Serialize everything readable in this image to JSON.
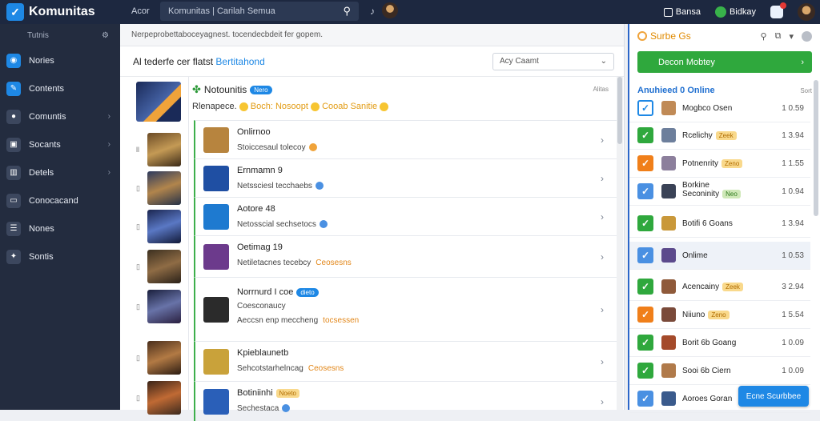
{
  "brand": {
    "name": "Komunitas"
  },
  "topbar": {
    "nav_label": "Acor",
    "search_text": "Komunitas | Carilah Semua",
    "pills": [
      {
        "label": "Bansa"
      },
      {
        "label": "Bidkay"
      }
    ]
  },
  "sidebar": {
    "header": "Tutnis",
    "items": [
      {
        "label": "Nories",
        "icon": "chat-icon",
        "color": "#1e88e5"
      },
      {
        "label": "Contents",
        "icon": "pencil-icon",
        "color": "#1e88e5"
      },
      {
        "label": "Comuntis",
        "icon": "bubble-icon",
        "color": "#3c475e"
      },
      {
        "label": "Socants",
        "icon": "box-icon",
        "color": "#3c475e"
      },
      {
        "label": "Detels",
        "icon": "chart-icon",
        "color": "#3c475e"
      },
      {
        "label": "Conocacand",
        "icon": "monitor-icon",
        "color": "#3c475e"
      },
      {
        "label": "Nones",
        "icon": "list-icon",
        "color": "#3c475e"
      },
      {
        "label": "Sontis",
        "icon": "pin-icon",
        "color": "#3c475e"
      }
    ]
  },
  "main": {
    "notice": "Nerpeprobettaboceyagnest. tocendecbdeit fer gopem.",
    "filter_title": "Al tederfe cer flatst",
    "filter_link": "Bertitahond",
    "select_value": "Acy Caamt",
    "feature": {
      "title": "Notounitis",
      "pill": "Nero",
      "subtitle_start": "Rlenapece.",
      "subtitle_mid": "Boch: Nosoopt",
      "subtitle_end": "Cooab Sanitie",
      "tag": "Alitas"
    },
    "rows": [
      {
        "title": "Onlirnoo",
        "sub": "Stoiccesaul tolecoy",
        "chip": "",
        "sub_chip": ""
      },
      {
        "title": "Ernmamn 9",
        "sub": "Netssciesl tecchaebs",
        "chip": "",
        "sub_chip": ""
      },
      {
        "title": "Aotore 48",
        "sub": "Netosscial sechsetocs",
        "chip": "",
        "sub_chip": ""
      },
      {
        "title": "Oetimag 19",
        "sub": "Netiletacnes tecebcy",
        "chip": "",
        "sub_chip": "Ceosesns"
      },
      {
        "title": "Norrnurd I coe",
        "sub2": "Coesconaucy",
        "sub": "Aeccsn enp meccheng",
        "chip": "dieto",
        "sub_chip": "tocsessen"
      },
      {
        "title": "Kpieblaunetb",
        "sub": "Sehcotstarhelncag",
        "chip": "",
        "sub_chip": "Ceosesns"
      },
      {
        "title": "Botiniinhi",
        "sub": "Sechestaca",
        "chip": "Noeto",
        "sub_chip": ""
      }
    ]
  },
  "right": {
    "title": "Surbe Gs",
    "join_label": "Decon Mobtey",
    "online_header": "Anuhieed 0 Online",
    "sort_label": "Sort",
    "online": [
      {
        "name": "Mogbco Osen",
        "time": "1 0.59",
        "chip": "",
        "check_color": "#1e88e5",
        "check_style": "outline"
      },
      {
        "name": "Rcelichy",
        "time": "1 3.94",
        "chip": "Zeek",
        "check_color": "#2fa83d",
        "check_style": "solid"
      },
      {
        "name": "Potnenrity",
        "time": "1 1.55",
        "chip": "Zeno",
        "check_color": "#f07f1a",
        "check_style": "solid"
      },
      {
        "name": "Borkine",
        "name2": "Seconinity",
        "time": "1 0.94",
        "chip": "Neo",
        "check_color": "#4a90e2",
        "check_style": "solid"
      },
      {
        "name": "Botifi 6 Goans",
        "time": "1 3.94",
        "chip": "",
        "check_color": "#2fa83d",
        "check_style": "solid"
      },
      {
        "name": "Onlime",
        "time": "1 0.53",
        "chip": "",
        "check_color": "#4a90e2",
        "check_style": "solid"
      },
      {
        "name": "Acencainy",
        "time": "3 2.94",
        "chip": "Zeek",
        "check_color": "#2fa83d",
        "check_style": "solid"
      },
      {
        "name": "Niiuno",
        "time": "1 5.54",
        "chip": "Zeno",
        "check_color": "#f07f1a",
        "check_style": "solid"
      },
      {
        "name": "Borit 6b Goang",
        "time": "1 0.09",
        "chip": "",
        "check_color": "#2fa83d",
        "check_style": "solid"
      },
      {
        "name": "Sooi 6b Ciern",
        "time": "1 0.09",
        "chip": "",
        "check_color": "#2fa83d",
        "check_style": "solid"
      },
      {
        "name": "Aoroes Goran",
        "time": "",
        "chip": "",
        "check_color": "#4a90e2",
        "check_style": "solid"
      }
    ],
    "float_button": "Ecne   Scurbbee"
  },
  "colors": {
    "topbar": "#1d2840",
    "sidebar": "#232c3f",
    "accent_blue": "#1e88e5",
    "accent_green": "#2fa83d",
    "accent_orange": "#f07f1a"
  }
}
